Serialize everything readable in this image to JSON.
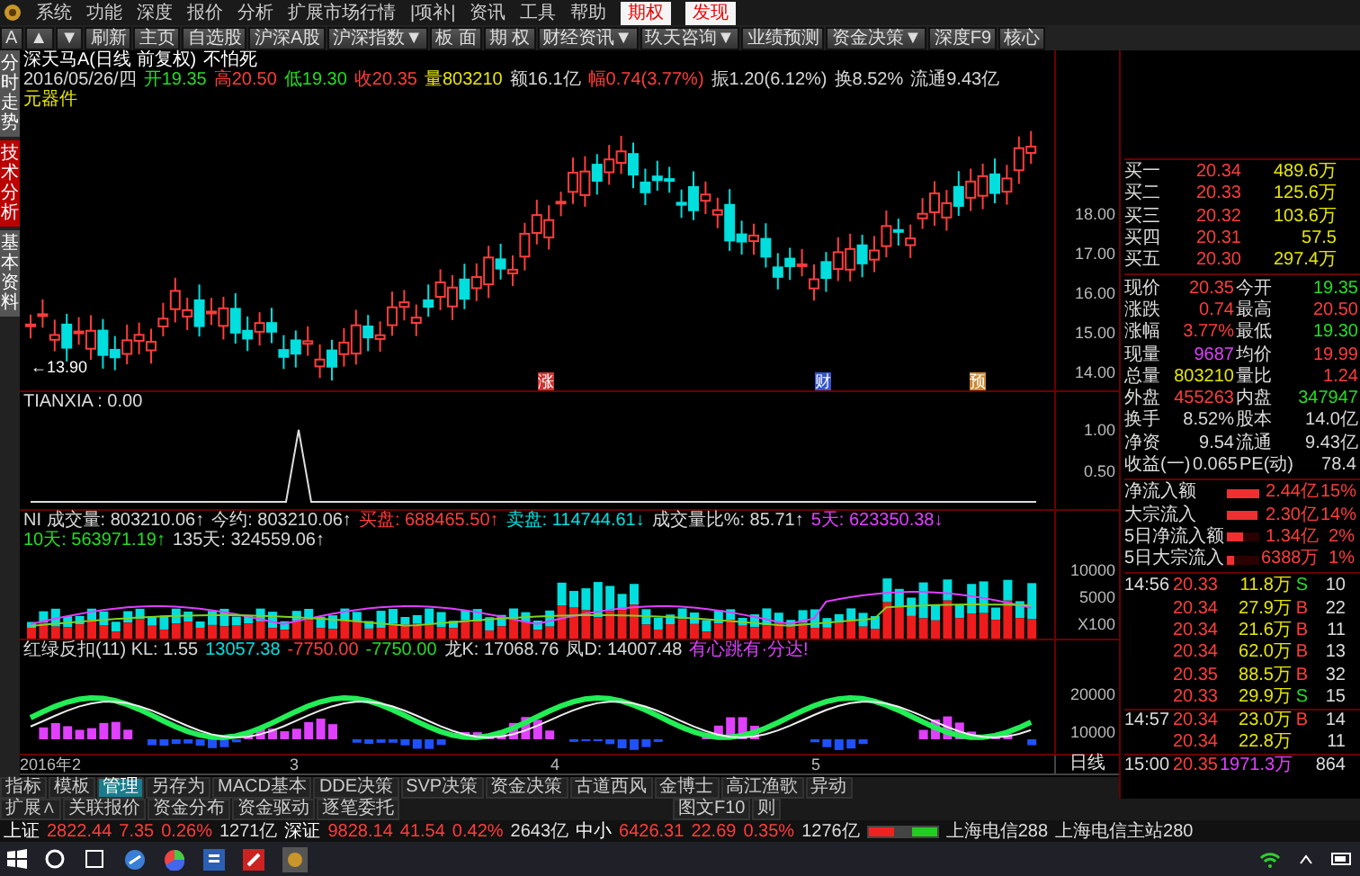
{
  "menu": [
    "系统",
    "功能",
    "深度",
    "报价",
    "分析",
    "扩展市场行情",
    "|项补|",
    "资讯",
    "工具",
    "帮助"
  ],
  "menu_tabs": [
    "期权",
    "发现"
  ],
  "toolbar": [
    "A",
    "▲",
    "▼",
    "刷新",
    "主页",
    "自选股",
    "沪深A股",
    "沪深指数▼",
    "板 面",
    "期 权",
    "财经资讯▼",
    "玖天咨询▼",
    "业绩预测",
    "资金决策▼",
    "深度F9",
    "核心"
  ],
  "side_tabs": [
    {
      "label": "分时走势",
      "selected": false
    },
    {
      "label": "技术分析",
      "selected": true
    },
    {
      "label": "基本资料",
      "selected": false
    }
  ],
  "chart": {
    "title": "深天马A(日线 前复权)",
    "note": "不怕死",
    "info": [
      {
        "text": "2016/05/26/四",
        "kind": "plain"
      },
      {
        "text": "开19.35",
        "kind": "down"
      },
      {
        "text": "高20.50",
        "kind": "up"
      },
      {
        "text": "低19.30",
        "kind": "down"
      },
      {
        "text": "收20.35",
        "kind": "up"
      },
      {
        "text": "量803210",
        "kind": "volume"
      },
      {
        "text": "额16.1亿",
        "kind": "plain"
      },
      {
        "text": "幅0.74(3.77%)",
        "kind": "up"
      },
      {
        "text": "振1.20(6.12%)",
        "kind": "plain"
      },
      {
        "text": "换8.52%",
        "kind": "plain"
      },
      {
        "text": "流通9.43亿",
        "kind": "plain"
      },
      {
        "text": "元器件",
        "kind": "volume"
      }
    ],
    "price_ticks": [
      "18.00",
      "17.00",
      "16.00",
      "15.00",
      "14.00"
    ],
    "low_marker": "←13.90",
    "events": [
      "涨",
      "财",
      "预"
    ]
  },
  "tianxia": {
    "label": "TIANXIA : 0.00",
    "ticks": [
      "1.00",
      "0.50"
    ]
  },
  "volume": {
    "readouts": [
      {
        "text": "NI 成交量: 803210.06↑",
        "kind": "plain"
      },
      {
        "text": "今约: 803210.06↑",
        "kind": "plain"
      },
      {
        "text": "买盘: 688465.50↑",
        "kind": "up"
      },
      {
        "text": "卖盘: 114744.61↓",
        "kind": "cyan"
      },
      {
        "text": "成交量比%: 85.71↑",
        "kind": "plain"
      },
      {
        "text": "5天: 623350.38↓",
        "kind": "purple"
      },
      {
        "text": "10天: 563971.19↑",
        "kind": "down"
      },
      {
        "text": "135天: 324559.06↑",
        "kind": "plain"
      }
    ],
    "ticks": [
      "10000",
      "5000"
    ],
    "unit": "X100"
  },
  "indicator": {
    "readouts": [
      {
        "text": "红绿反扣(11) KL: 1.55",
        "kind": "plain"
      },
      {
        "text": "13057.38",
        "kind": "cyan"
      },
      {
        "text": "-7750.00",
        "kind": "up"
      },
      {
        "text": "-7750.00",
        "kind": "down"
      },
      {
        "text": "龙K: 17068.76",
        "kind": "plain"
      },
      {
        "text": "凤D: 14007.48",
        "kind": "plain"
      },
      {
        "text": "有心跳有·分达!",
        "kind": "purple"
      }
    ],
    "ticks": [
      "20000",
      "10000"
    ]
  },
  "dates": [
    "2016年2",
    "3",
    "4",
    "5"
  ],
  "period": "日线",
  "indicator_tabs": [
    {
      "label": "指标",
      "selected": false
    },
    {
      "label": "模板",
      "selected": false
    },
    {
      "label": "管理",
      "selected": true
    },
    {
      "label": "另存为",
      "selected": false
    },
    {
      "label": "MACD基本",
      "selected": false
    },
    {
      "label": "DDE决策",
      "selected": false
    },
    {
      "label": "SVP决策",
      "selected": false
    },
    {
      "label": "资金决策",
      "selected": false
    },
    {
      "label": "古道西风",
      "selected": false
    },
    {
      "label": "金博士",
      "selected": false
    },
    {
      "label": "高江渔歌",
      "selected": false
    },
    {
      "label": "异动",
      "selected": false
    }
  ],
  "ext_tabs": [
    "扩展∧",
    "关联报价",
    "资金分布",
    "资金驱动",
    "逐笔委托"
  ],
  "ext_right": [
    "图文F10",
    "则"
  ],
  "quote": {
    "bids": [
      {
        "label": "买一",
        "price": "20.34",
        "volume": "489.6万"
      },
      {
        "label": "买二",
        "price": "20.33",
        "volume": "125.6万"
      },
      {
        "label": "买三",
        "price": "20.32",
        "volume": "103.6万"
      },
      {
        "label": "买四",
        "price": "20.31",
        "volume": "57.5"
      },
      {
        "label": "买五",
        "price": "20.30",
        "volume": "297.4万"
      }
    ],
    "stats": [
      {
        "label": "现价",
        "value": "20.35",
        "kind": "up"
      },
      {
        "label": "今开",
        "value": "19.35",
        "kind": "down"
      },
      {
        "label": "涨跌",
        "value": "0.74",
        "kind": "up"
      },
      {
        "label": "最高",
        "value": "20.50",
        "kind": "up"
      },
      {
        "label": "涨幅",
        "value": "3.77%",
        "kind": "up"
      },
      {
        "label": "最低",
        "value": "19.30",
        "kind": "down"
      },
      {
        "label": "现量",
        "value": "9687",
        "kind": "purple"
      },
      {
        "label": "均价",
        "value": "19.99",
        "kind": "up"
      },
      {
        "label": "总量",
        "value": "803210",
        "kind": "volume"
      },
      {
        "label": "量比",
        "value": "1.24",
        "kind": "up"
      },
      {
        "label": "外盘",
        "value": "455263",
        "kind": "up"
      },
      {
        "label": "内盘",
        "value": "347947",
        "kind": "down"
      },
      {
        "label": "换手",
        "value": "8.52%",
        "kind": "plain"
      },
      {
        "label": "股本",
        "value": "14.0亿",
        "kind": "plain"
      },
      {
        "label": "净资",
        "value": "9.54",
        "kind": "plain"
      },
      {
        "label": "流通",
        "value": "9.43亿",
        "kind": "plain"
      },
      {
        "label": "收益(一)",
        "value": "0.065",
        "kind": "plain"
      },
      {
        "label": "PE(动)",
        "value": "78.4",
        "kind": "plain"
      }
    ],
    "flows": [
      {
        "label": "净流入额",
        "level": 1,
        "amount": "2.44亿",
        "pct": "15%"
      },
      {
        "label": "大宗流入",
        "level": 0.95,
        "amount": "2.30亿",
        "pct": "14%"
      },
      {
        "label": "5日净流入额",
        "level": 0.5,
        "amount": "1.34亿",
        "pct": "2%"
      },
      {
        "label": "5日大宗流入",
        "level": 0.2,
        "amount": "6388万",
        "pct": "1%"
      }
    ],
    "trades": [
      {
        "time": "14:56",
        "price": "20.33",
        "volume": "11.8万",
        "side": "S",
        "count": "10"
      },
      {
        "price": "20.34",
        "volume": "27.9万",
        "side": "B",
        "count": "22"
      },
      {
        "price": "20.34",
        "volume": "21.6万",
        "side": "B",
        "count": "11"
      },
      {
        "price": "20.34",
        "volume": "62.0万",
        "side": "B",
        "count": "13"
      },
      {
        "price": "20.35",
        "volume": "88.5万",
        "side": "B",
        "count": "32"
      },
      {
        "price": "20.33",
        "volume": "29.9万",
        "side": "S",
        "count": "15"
      },
      {
        "time": "14:57",
        "price": "20.34",
        "volume": "23.0万",
        "side": "B",
        "count": "14"
      },
      {
        "price": "20.34",
        "volume": "22.8万",
        "count": "11"
      },
      {
        "time": "15:00",
        "price": "20.35",
        "volume": "1971.3万",
        "kind": "purple",
        "count": "864"
      }
    ]
  },
  "indices": [
    {
      "name": "上证",
      "value": "2822.44",
      "change": "7.35",
      "pct": "0.26%",
      "amount": "1271亿"
    },
    {
      "name": "深证",
      "value": "9828.14",
      "change": "41.54",
      "pct": "0.42%",
      "amount": "2643亿"
    },
    {
      "name": "中小",
      "value": "6426.31",
      "change": "22.69",
      "pct": "0.35%",
      "amount": "1276亿"
    }
  ],
  "servers": [
    "上海电信288",
    "上海电信主站280"
  ]
}
